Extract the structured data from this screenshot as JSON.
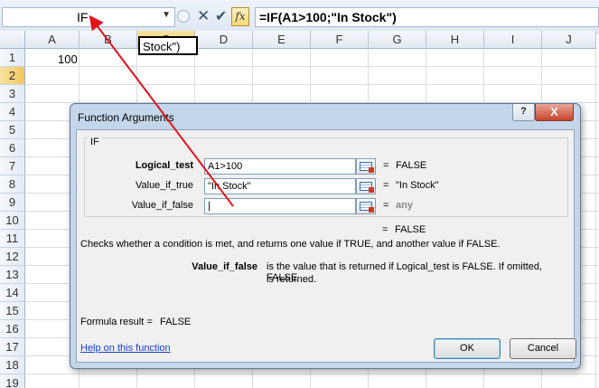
{
  "formula_bar": {
    "name_box_value": "IF",
    "formula": "=IF(A1>100;\"In Stock\")"
  },
  "grid": {
    "columns": [
      "A",
      "B",
      "C",
      "D",
      "E",
      "F",
      "G",
      "H",
      "I",
      "J"
    ],
    "active_column": "C",
    "rows": [
      "1",
      "2",
      "3",
      "4",
      "5",
      "6",
      "7",
      "8",
      "9",
      "10",
      "11",
      "12",
      "13",
      "14",
      "15",
      "16",
      "17",
      "18",
      "19"
    ],
    "active_row": "2",
    "cells": {
      "A1": "100",
      "C2": "Stock\")"
    }
  },
  "dialog": {
    "title": "Function Arguments",
    "help_button": "?",
    "close_button": "X",
    "group_label": "IF",
    "arguments": [
      {
        "label": "Logical_test",
        "value": "A1>100",
        "result": "FALSE",
        "bold": true
      },
      {
        "label": "Value_if_true",
        "value": "\"In Stock\"",
        "result": "\"In Stock\"",
        "bold": false
      },
      {
        "label": "Value_if_false",
        "value": "|",
        "result": "any",
        "bold": false
      }
    ],
    "overall_result": "FALSE",
    "description": "Checks whether a condition is met, and returns one value if TRUE, and another value if FALSE.",
    "arg_help_name": "Value_if_false",
    "arg_help_text_1": "is the value that is returned if Logical_test is FALSE. If omitted, FALSE",
    "arg_help_text_2": "is returned.",
    "formula_result_label": "Formula result =",
    "formula_result_value": "FALSE",
    "help_link": "Help on this function",
    "ok_button": "OK",
    "cancel_button": "Cancel"
  },
  "colors": {
    "annotation_arrow": "#e0141b",
    "dialog_frame": "#c3d6ea",
    "active_header": "#f2c55c"
  }
}
